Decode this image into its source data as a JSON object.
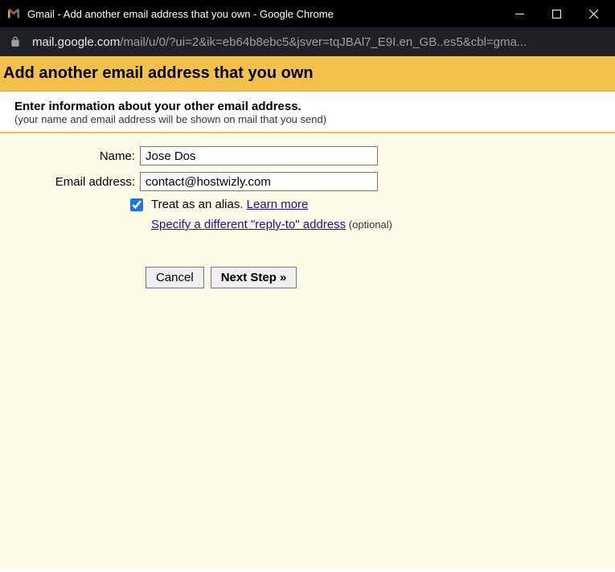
{
  "window": {
    "title": "Gmail - Add another email address that you own - Google Chrome"
  },
  "address": {
    "host": "mail.google.com",
    "path": "/mail/u/0/?ui=2&ik=eb64b8ebc5&jsver=tqJBAl7_E9I.en_GB..es5&cbl=gma..."
  },
  "header": {
    "title": "Add another email address that you own"
  },
  "subheader": {
    "title": "Enter information about your other email address.",
    "note": "(your name and email address will be shown on mail that you send)"
  },
  "form": {
    "name_label": "Name:",
    "name_value": "Jose Dos",
    "email_label": "Email address:",
    "email_value": "contact@hostwizly.com",
    "alias_checked": true,
    "alias_text": "Treat as an alias. ",
    "alias_link": "Learn more",
    "reply_link": "Specify a different \"reply-to\" address",
    "optional": " (optional)"
  },
  "buttons": {
    "cancel": "Cancel",
    "next": "Next Step »"
  }
}
